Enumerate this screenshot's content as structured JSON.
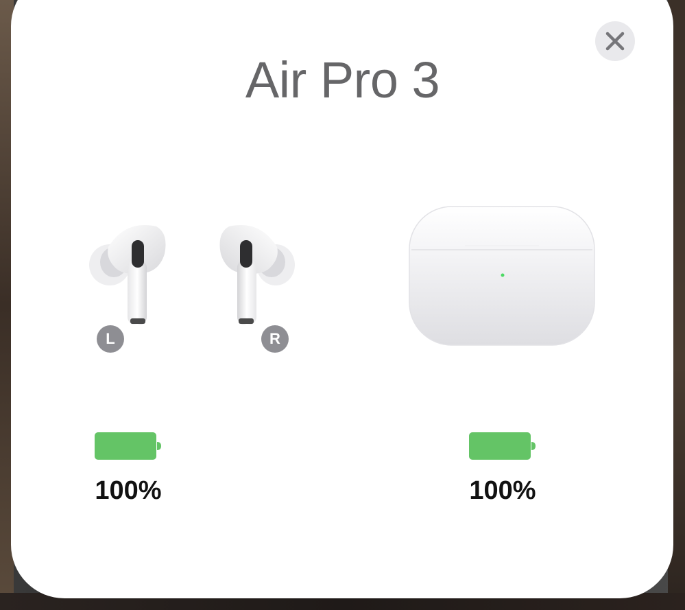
{
  "popup": {
    "title": "Air Pro 3",
    "close_icon": "close-icon"
  },
  "earbuds": {
    "left_badge": "L",
    "right_badge": "R",
    "battery_percent": 1.0,
    "battery_label": "100%"
  },
  "case": {
    "battery_percent": 1.0,
    "battery_label": "100%"
  },
  "colors": {
    "battery_green": "#64c466",
    "badge_gray": "#8e8e93",
    "title_gray": "#666668",
    "close_bg": "#e9e9ec"
  }
}
